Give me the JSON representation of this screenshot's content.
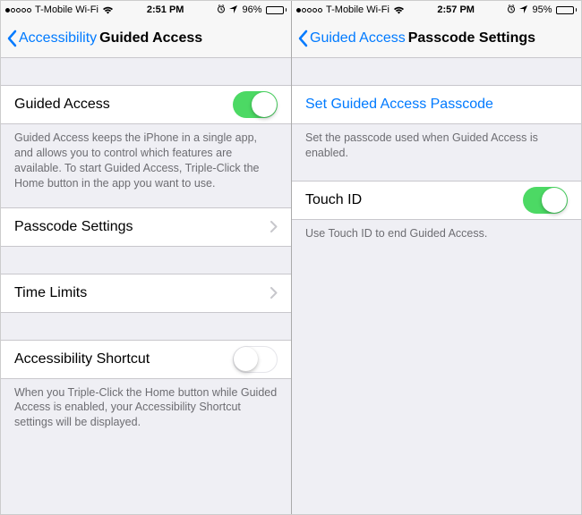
{
  "left": {
    "status": {
      "carrier": "T-Mobile Wi-Fi",
      "time": "2:51 PM",
      "battery_pct": "96%",
      "battery_fill": 96,
      "signal_filled": 1
    },
    "nav": {
      "back": "Accessibility",
      "title": "Guided Access"
    },
    "rows": {
      "guided_access": "Guided Access",
      "guided_access_on": true,
      "guided_access_footer": "Guided Access keeps the iPhone in a single app, and allows you to control which features are available. To start Guided Access, Triple-Click the Home button in the app you want to use.",
      "passcode_settings": "Passcode Settings",
      "time_limits": "Time Limits",
      "accessibility_shortcut": "Accessibility Shortcut",
      "accessibility_shortcut_on": false,
      "accessibility_shortcut_footer": "When you Triple-Click the Home button while Guided Access is enabled, your Accessibility Shortcut settings will be displayed."
    }
  },
  "right": {
    "status": {
      "carrier": "T-Mobile Wi-Fi",
      "time": "2:57 PM",
      "battery_pct": "95%",
      "battery_fill": 95,
      "signal_filled": 1
    },
    "nav": {
      "back": "Guided Access",
      "title": "Passcode Settings"
    },
    "rows": {
      "set_passcode": "Set Guided Access Passcode",
      "set_passcode_footer": "Set the passcode used when Guided Access is enabled.",
      "touch_id": "Touch ID",
      "touch_id_on": true,
      "touch_id_footer": "Use Touch ID to end Guided Access."
    }
  }
}
